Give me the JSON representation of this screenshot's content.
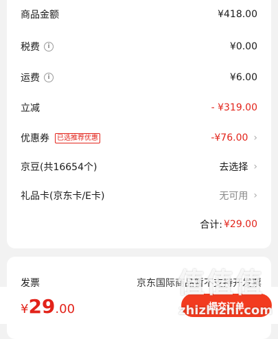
{
  "summary": {
    "goods_amount": {
      "label": "商品金额",
      "value": "¥418.00"
    },
    "tax": {
      "label": "税费",
      "value": "¥0.00"
    },
    "shipping": {
      "label": "运费",
      "value": "¥6.00"
    },
    "instant_discount": {
      "label": "立减",
      "value": "- ¥319.00"
    },
    "coupon": {
      "label": "优惠券",
      "tag": "已选推荐优惠",
      "value": "-¥76.00"
    },
    "jingdou": {
      "label": "京豆(共16654个)",
      "value": "去选择"
    },
    "gift_card": {
      "label": "礼品卡(京东卡/E卡)",
      "value": "无可用"
    },
    "total": {
      "label": "合计:",
      "value": "¥29.00"
    }
  },
  "invoice": {
    "label": "发票",
    "value": "京东国际商品暂不支持开发票"
  },
  "footer": {
    "currency": "¥",
    "price_int": "29",
    "price_dec": ".00",
    "submit_label": "提交订单"
  },
  "watermark": {
    "logo": "值",
    "url": "zhizhizhi.com"
  },
  "colors": {
    "accent": "#e2231a",
    "button": "#f23b1f",
    "background": "#f2f2f2"
  },
  "icons": {
    "info": "info-icon",
    "chevron": "chevron-right-icon"
  }
}
